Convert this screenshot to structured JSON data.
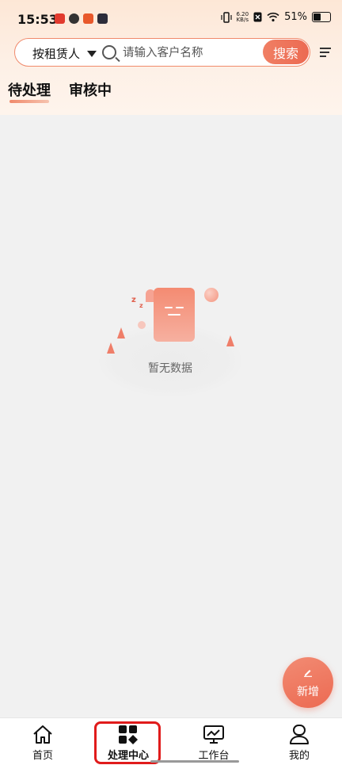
{
  "status_bar": {
    "time": "15:53",
    "net_speed_value": "6.20",
    "net_speed_unit": "KB/s",
    "battery": "51%",
    "battery_level": 0.51
  },
  "search": {
    "scope_label": "按租赁人",
    "placeholder": "请输入客户名称",
    "button_label": "搜索"
  },
  "tabs": [
    {
      "label": "待处理",
      "active": true
    },
    {
      "label": "审核中",
      "active": false
    }
  ],
  "empty_state": {
    "text": "暂无数据"
  },
  "fab": {
    "label": "新增"
  },
  "bottom_nav": [
    {
      "label": "首页",
      "icon": "home-icon"
    },
    {
      "label": "处理中心",
      "icon": "grid-icon",
      "active": true
    },
    {
      "label": "工作台",
      "icon": "monitor-chart-icon"
    },
    {
      "label": "我的",
      "icon": "user-icon"
    }
  ],
  "colors": {
    "accent": "#ec6a52",
    "highlight": "#e01b1b"
  }
}
